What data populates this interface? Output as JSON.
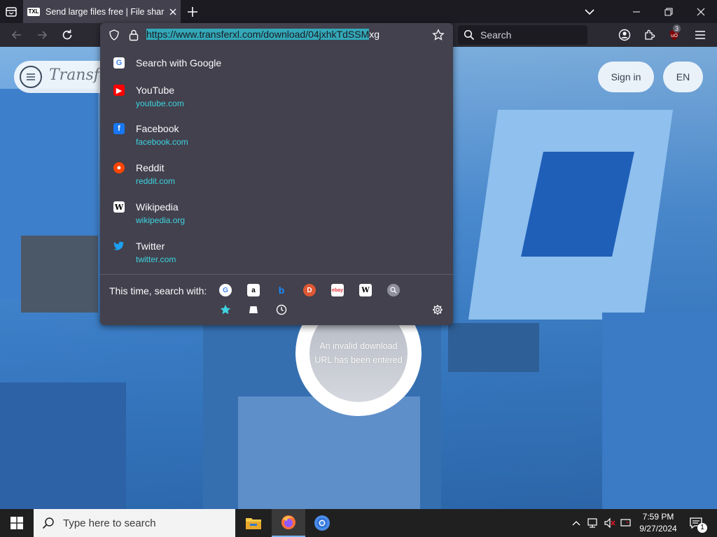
{
  "browser": {
    "tab": {
      "favicon_text": "TXL",
      "title": "Send large files free | File sharing"
    },
    "search_placeholder": "Search",
    "extensions_badge": "3"
  },
  "urlbar": {
    "url_selected": "https://www.transferxl.com/download/04jxhkTdSSM",
    "url_rest": "xg"
  },
  "dropdown": {
    "search_with": "Search with Google",
    "suggestions": [
      {
        "title": "YouTube",
        "url": "youtube.com",
        "icon": "youtube-icon",
        "color": "#ff0000"
      },
      {
        "title": "Facebook",
        "url": "facebook.com",
        "icon": "facebook-icon",
        "color": "#1877f2"
      },
      {
        "title": "Reddit",
        "url": "reddit.com",
        "icon": "reddit-icon",
        "color": "#ff4500"
      },
      {
        "title": "Wikipedia",
        "url": "wikipedia.org",
        "icon": "wikipedia-icon",
        "color": "#ffffff"
      },
      {
        "title": "Twitter",
        "url": "twitter.com",
        "icon": "twitter-icon",
        "color": "#1da1f2"
      }
    ],
    "one_off_label": "This time, search with:"
  },
  "page": {
    "logo_text": "TransferXL",
    "signin_label": "Sign in",
    "lang_label": "EN",
    "error_line1": "An invalid download",
    "error_line2": "URL has been entered"
  },
  "taskbar": {
    "search_placeholder": "Type here to search",
    "time": "7:59 PM",
    "date": "9/27/2024",
    "notification_count": "1"
  }
}
